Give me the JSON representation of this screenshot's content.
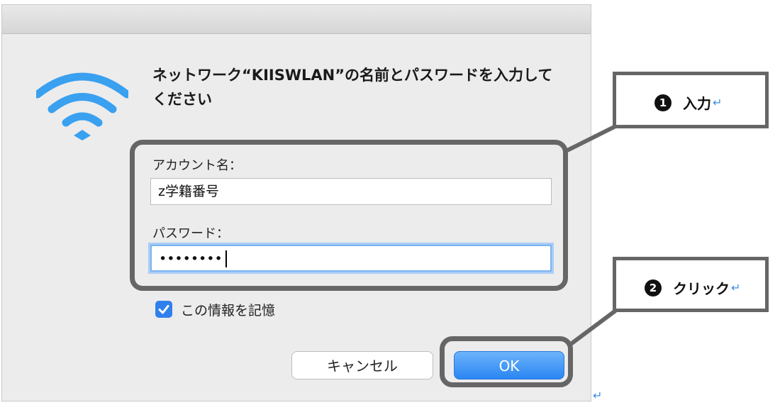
{
  "dialog": {
    "prompt": "ネットワーク“KIISWLAN”の名前とパスワードを入力してください",
    "account_label": "アカウント名：",
    "account_value": "z学籍番号",
    "password_label": "パスワード：",
    "password_value": "••••••••",
    "remember_label": "この情報を記憶",
    "remember_checked": true,
    "cancel_label": "キャンセル",
    "ok_label": "OK"
  },
  "annotations": {
    "step1_number": "1",
    "step1_label": "入力",
    "step2_number": "2",
    "step2_label": "クリック",
    "return_mark": "↵"
  },
  "colors": {
    "accent": "#2f80ed",
    "wifi": "#3aa0f0",
    "annotation_border": "#666666",
    "return_mark": "#3b8de6"
  }
}
